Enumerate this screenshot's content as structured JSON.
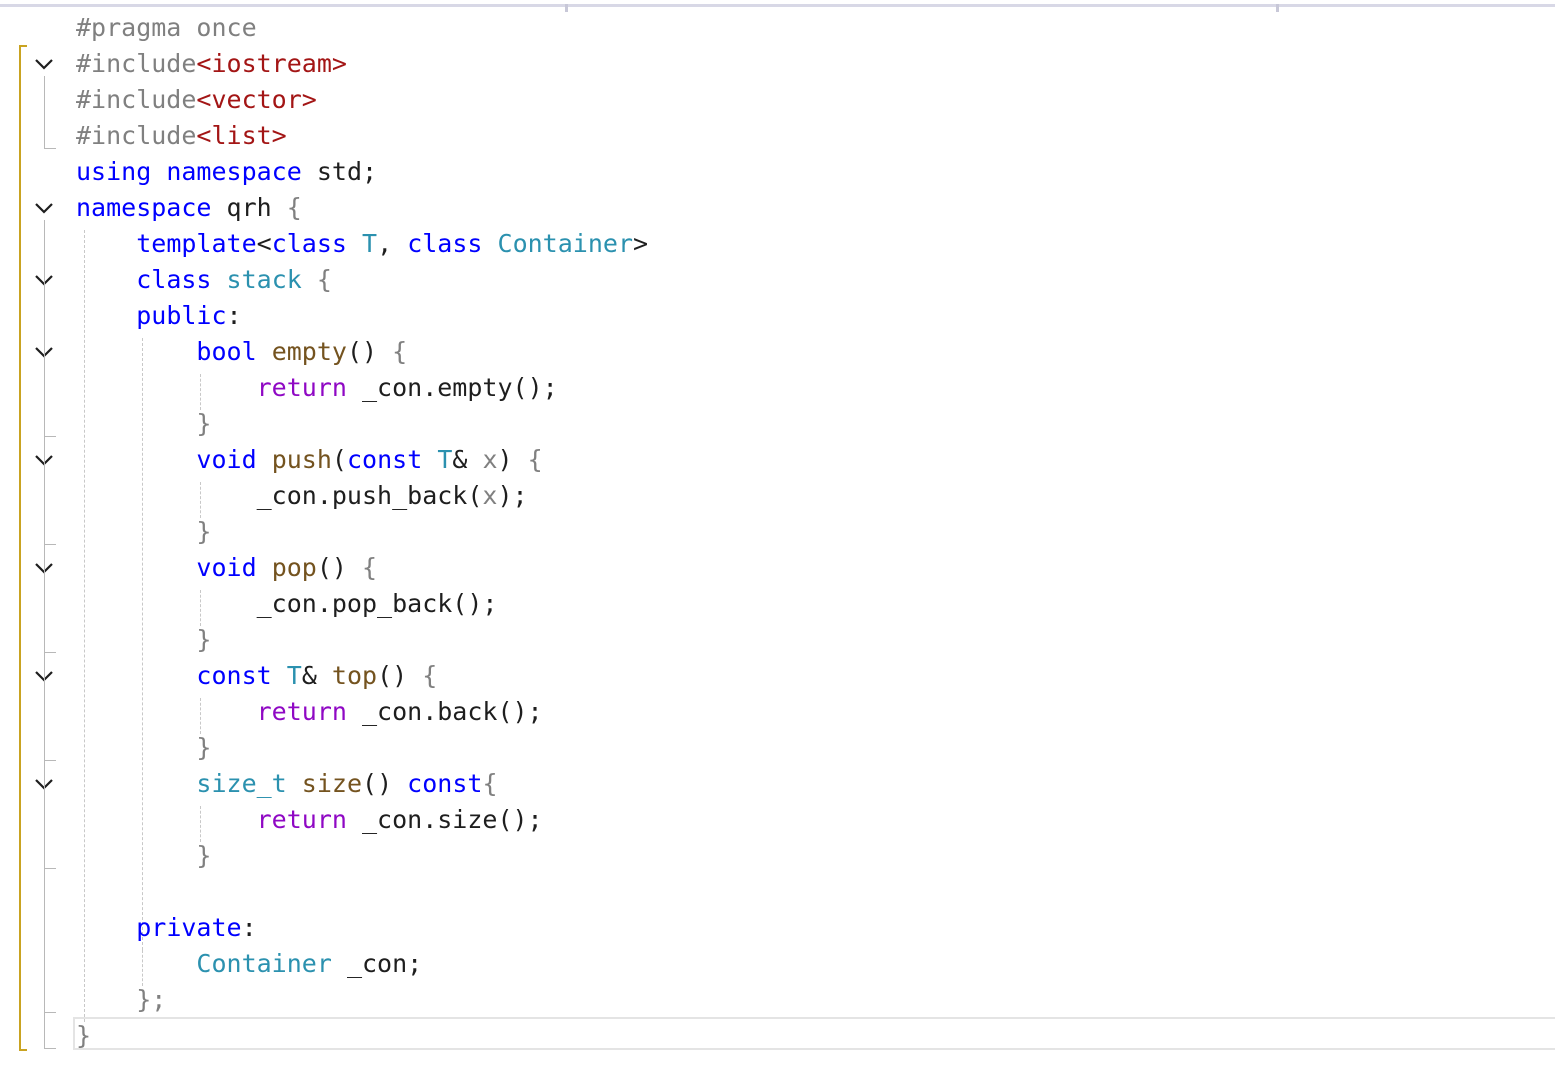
{
  "editor": {
    "lines": [
      {
        "id": "l1",
        "tokens": [
          {
            "t": "#pragma once",
            "c": "pp"
          }
        ]
      },
      {
        "id": "l2",
        "tokens": [
          {
            "t": "#include",
            "c": "pp"
          },
          {
            "t": "<iostream>",
            "c": "inc"
          }
        ]
      },
      {
        "id": "l3",
        "tokens": [
          {
            "t": "#include",
            "c": "pp"
          },
          {
            "t": "<vector>",
            "c": "inc"
          }
        ]
      },
      {
        "id": "l4",
        "tokens": [
          {
            "t": "#include",
            "c": "pp"
          },
          {
            "t": "<list>",
            "c": "inc"
          }
        ]
      },
      {
        "id": "l5",
        "tokens": [
          {
            "t": "using",
            "c": "kw"
          },
          {
            "t": " ",
            "c": "pu"
          },
          {
            "t": "namespace",
            "c": "kw"
          },
          {
            "t": " std;",
            "c": "pu"
          }
        ]
      },
      {
        "id": "l6",
        "tokens": [
          {
            "t": "namespace",
            "c": "kw"
          },
          {
            "t": " qrh ",
            "c": "pu"
          },
          {
            "t": "{",
            "c": "br"
          }
        ]
      },
      {
        "id": "l7",
        "tokens": [
          {
            "t": "    ",
            "c": "pu"
          },
          {
            "t": "template",
            "c": "kw"
          },
          {
            "t": "<",
            "c": "pu"
          },
          {
            "t": "class",
            "c": "kw"
          },
          {
            "t": " ",
            "c": "pu"
          },
          {
            "t": "T",
            "c": "ty"
          },
          {
            "t": ", ",
            "c": "pu"
          },
          {
            "t": "class",
            "c": "kw"
          },
          {
            "t": " ",
            "c": "pu"
          },
          {
            "t": "Container",
            "c": "ty"
          },
          {
            "t": ">",
            "c": "pu"
          }
        ]
      },
      {
        "id": "l8",
        "tokens": [
          {
            "t": "    ",
            "c": "pu"
          },
          {
            "t": "class",
            "c": "kw"
          },
          {
            "t": " ",
            "c": "pu"
          },
          {
            "t": "stack",
            "c": "ty"
          },
          {
            "t": " ",
            "c": "pu"
          },
          {
            "t": "{",
            "c": "br"
          }
        ]
      },
      {
        "id": "l9",
        "tokens": [
          {
            "t": "    ",
            "c": "pu"
          },
          {
            "t": "public",
            "c": "kw"
          },
          {
            "t": ":",
            "c": "pu"
          }
        ]
      },
      {
        "id": "l10",
        "tokens": [
          {
            "t": "        ",
            "c": "pu"
          },
          {
            "t": "bool",
            "c": "kw"
          },
          {
            "t": " ",
            "c": "pu"
          },
          {
            "t": "empty",
            "c": "fn"
          },
          {
            "t": "() ",
            "c": "pu"
          },
          {
            "t": "{",
            "c": "br"
          }
        ]
      },
      {
        "id": "l11",
        "tokens": [
          {
            "t": "            ",
            "c": "pu"
          },
          {
            "t": "return",
            "c": "kw2"
          },
          {
            "t": " _con.",
            "c": "pu"
          },
          {
            "t": "empty",
            "c": "pu"
          },
          {
            "t": "();",
            "c": "pu"
          }
        ]
      },
      {
        "id": "l12",
        "tokens": [
          {
            "t": "        ",
            "c": "pu"
          },
          {
            "t": "}",
            "c": "br"
          }
        ]
      },
      {
        "id": "l13",
        "tokens": [
          {
            "t": "        ",
            "c": "pu"
          },
          {
            "t": "void",
            "c": "kw"
          },
          {
            "t": " ",
            "c": "pu"
          },
          {
            "t": "push",
            "c": "fn"
          },
          {
            "t": "(",
            "c": "pu"
          },
          {
            "t": "const",
            "c": "kw"
          },
          {
            "t": " ",
            "c": "pu"
          },
          {
            "t": "T",
            "c": "ty"
          },
          {
            "t": "& ",
            "c": "pu"
          },
          {
            "t": "x",
            "c": "pm"
          },
          {
            "t": ") ",
            "c": "pu"
          },
          {
            "t": "{",
            "c": "br"
          }
        ]
      },
      {
        "id": "l14",
        "tokens": [
          {
            "t": "            ",
            "c": "pu"
          },
          {
            "t": "_con.push_back(",
            "c": "pu"
          },
          {
            "t": "x",
            "c": "pm"
          },
          {
            "t": ");",
            "c": "pu"
          }
        ]
      },
      {
        "id": "l15",
        "tokens": [
          {
            "t": "        ",
            "c": "pu"
          },
          {
            "t": "}",
            "c": "br"
          }
        ]
      },
      {
        "id": "l16",
        "tokens": [
          {
            "t": "        ",
            "c": "pu"
          },
          {
            "t": "void",
            "c": "kw"
          },
          {
            "t": " ",
            "c": "pu"
          },
          {
            "t": "pop",
            "c": "fn"
          },
          {
            "t": "() ",
            "c": "pu"
          },
          {
            "t": "{",
            "c": "br"
          }
        ]
      },
      {
        "id": "l17",
        "tokens": [
          {
            "t": "            ",
            "c": "pu"
          },
          {
            "t": "_con.pop_back();",
            "c": "pu"
          }
        ]
      },
      {
        "id": "l18",
        "tokens": [
          {
            "t": "        ",
            "c": "pu"
          },
          {
            "t": "}",
            "c": "br"
          }
        ]
      },
      {
        "id": "l19",
        "tokens": [
          {
            "t": "        ",
            "c": "pu"
          },
          {
            "t": "const",
            "c": "kw"
          },
          {
            "t": " ",
            "c": "pu"
          },
          {
            "t": "T",
            "c": "ty"
          },
          {
            "t": "& ",
            "c": "pu"
          },
          {
            "t": "top",
            "c": "fn"
          },
          {
            "t": "() ",
            "c": "pu"
          },
          {
            "t": "{",
            "c": "br"
          }
        ]
      },
      {
        "id": "l20",
        "tokens": [
          {
            "t": "            ",
            "c": "pu"
          },
          {
            "t": "return",
            "c": "kw2"
          },
          {
            "t": " _con.back();",
            "c": "pu"
          }
        ]
      },
      {
        "id": "l21",
        "tokens": [
          {
            "t": "        ",
            "c": "pu"
          },
          {
            "t": "}",
            "c": "br"
          }
        ]
      },
      {
        "id": "l22",
        "tokens": [
          {
            "t": "        ",
            "c": "pu"
          },
          {
            "t": "size_t",
            "c": "ty"
          },
          {
            "t": " ",
            "c": "pu"
          },
          {
            "t": "size",
            "c": "fn"
          },
          {
            "t": "() ",
            "c": "pu"
          },
          {
            "t": "const",
            "c": "kw"
          },
          {
            "t": "{",
            "c": "br"
          }
        ]
      },
      {
        "id": "l23",
        "tokens": [
          {
            "t": "            ",
            "c": "pu"
          },
          {
            "t": "return",
            "c": "kw2"
          },
          {
            "t": " _con.size();",
            "c": "pu"
          }
        ]
      },
      {
        "id": "l24",
        "tokens": [
          {
            "t": "        ",
            "c": "pu"
          },
          {
            "t": "}",
            "c": "br"
          }
        ]
      },
      {
        "id": "l25",
        "tokens": [
          {
            "t": "",
            "c": "pu"
          }
        ]
      },
      {
        "id": "l26",
        "tokens": [
          {
            "t": "    ",
            "c": "pu"
          },
          {
            "t": "private",
            "c": "kw"
          },
          {
            "t": ":",
            "c": "pu"
          }
        ]
      },
      {
        "id": "l27",
        "tokens": [
          {
            "t": "        ",
            "c": "pu"
          },
          {
            "t": "Container",
            "c": "ty"
          },
          {
            "t": " _con;",
            "c": "pu"
          }
        ]
      },
      {
        "id": "l28",
        "tokens": [
          {
            "t": "    ",
            "c": "pu"
          },
          {
            "t": "};",
            "c": "br"
          }
        ]
      },
      {
        "id": "l29",
        "tokens": [
          {
            "t": "}",
            "c": "br"
          }
        ]
      }
    ],
    "fold_icon": "chevron-down-icon",
    "colors": {
      "keyword": "#0000ff",
      "control_keyword": "#8f08c4",
      "type": "#2b91af",
      "function": "#74531f",
      "preprocessor": "#808080",
      "include_path": "#a31515",
      "change_marker": "#c9a321"
    }
  }
}
